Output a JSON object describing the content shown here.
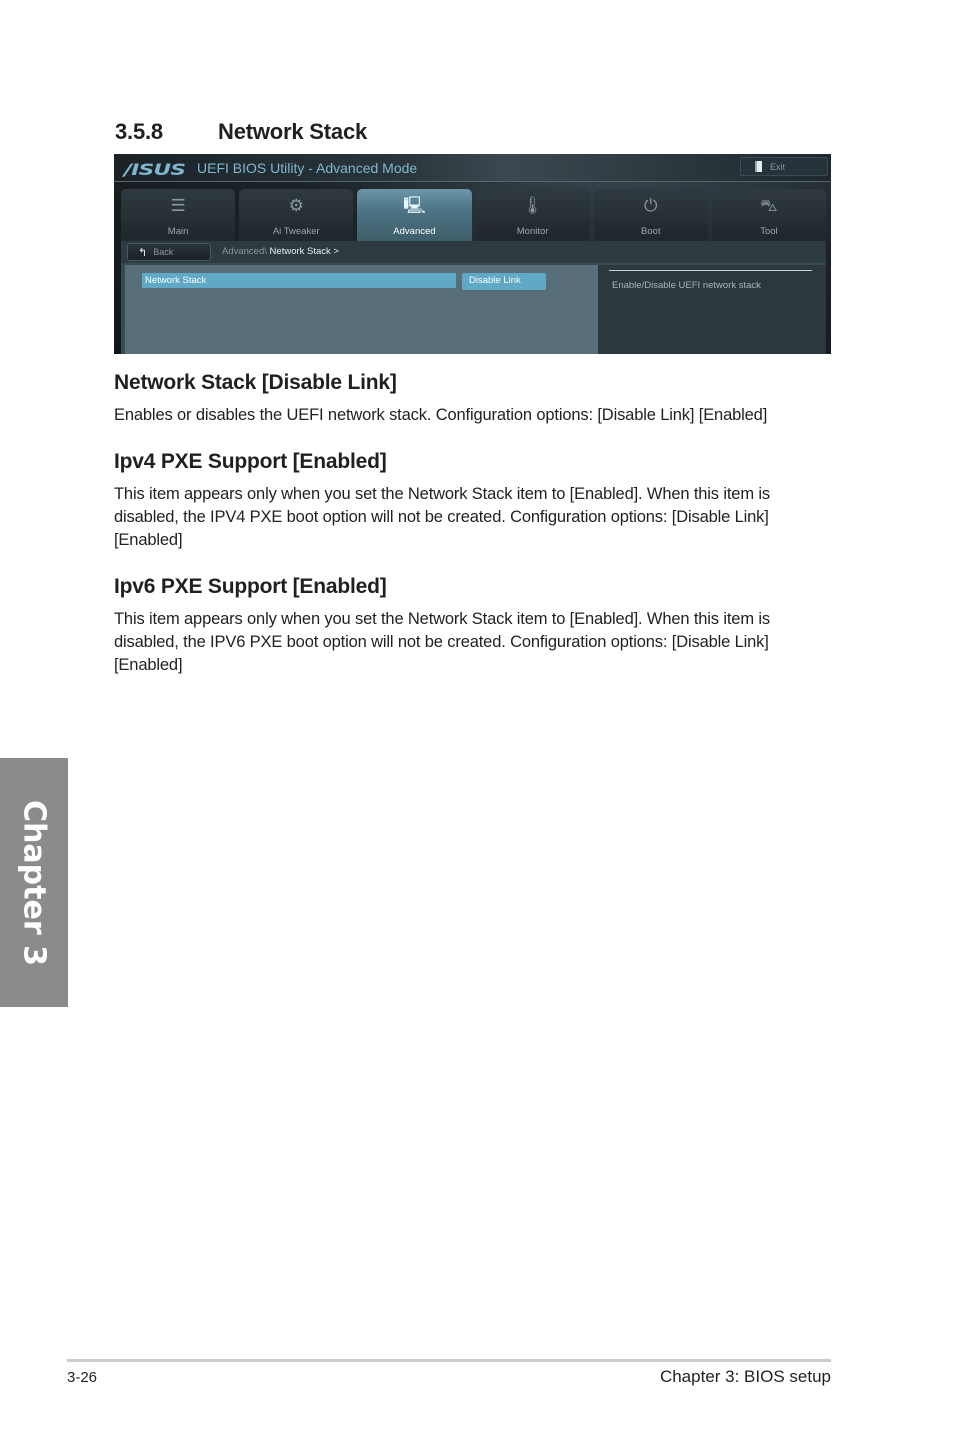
{
  "section": {
    "number": "3.5.8",
    "title": "Network Stack"
  },
  "bios": {
    "logo": "/ISUS",
    "title": "UEFI BIOS Utility - Advanced Mode",
    "exit_label": "Exit",
    "tabs": [
      {
        "label": "Main",
        "icon": "list-icon",
        "glyph": "☰"
      },
      {
        "label": "Ai  Tweaker",
        "icon": "fan-icon",
        "glyph": "⚙"
      },
      {
        "label": "Advanced",
        "icon": "advanced-info-icon",
        "glyph": "🖳",
        "active": true
      },
      {
        "label": "Monitor",
        "icon": "thermometer-gauge-icon",
        "glyph": "🌡"
      },
      {
        "label": "Boot",
        "icon": "power-icon",
        "glyph": "⏻"
      },
      {
        "label": "Tool",
        "icon": "toolbox-icon",
        "glyph": "⛍"
      }
    ],
    "back_label": "Back",
    "breadcrumb": {
      "parent": "Advanced\\",
      "current": " Network Stack  >"
    },
    "settings": [
      {
        "name": "Network Stack",
        "value": "Disable Link"
      }
    ],
    "help_text": "Enable/Disable UEFI network stack"
  },
  "items": [
    {
      "heading": "Network Stack [Disable Link]",
      "text": "Enables or disables the UEFI network stack. Configuration options: [Disable Link] [Enabled]"
    },
    {
      "heading": "Ipv4 PXE Support [Enabled]",
      "text": "This item appears only when you set the Network Stack item to [Enabled]. When this item is disabled, the IPV4 PXE boot option will not be created. Configuration options: [Disable Link] [Enabled]"
    },
    {
      "heading": "Ipv6 PXE Support [Enabled]",
      "text": "This item appears only when you set the Network Stack item to [Enabled]. When this item is disabled, the IPV6 PXE boot option will not be created. Configuration options: [Disable Link] [Enabled]"
    }
  ],
  "side_tab": "Chapter 3",
  "footer": {
    "page_number": "3-26",
    "chapter": "Chapter 3: BIOS setup"
  }
}
